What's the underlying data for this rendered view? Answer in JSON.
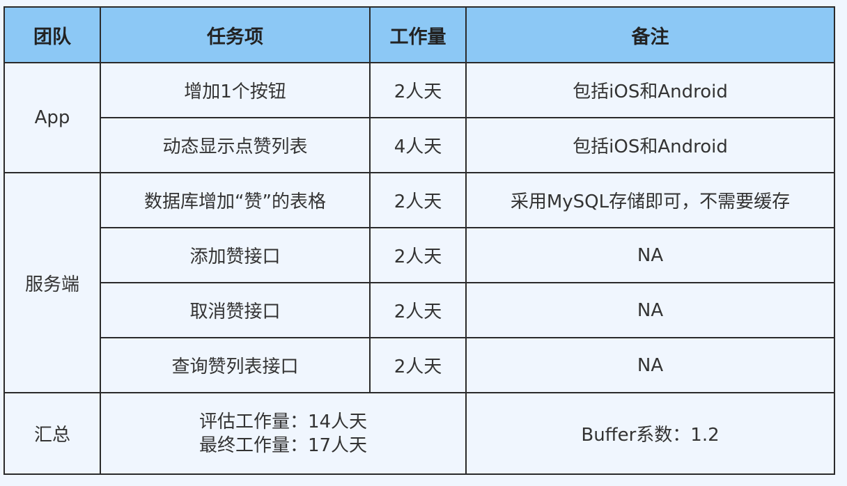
{
  "headers": [
    "团队",
    "任务项",
    "工作量",
    "备注"
  ],
  "groups": {
    "app": "App",
    "server": "服务端",
    "summary": "汇总"
  },
  "rows": [
    {
      "task": "增加1个按钮",
      "effort": "2人天",
      "note": "包括iOS和Android"
    },
    {
      "task": "动态显示点赞列表",
      "effort": "4人天",
      "note": "包括iOS和Android"
    },
    {
      "task": "数据库增加“赞”的表格",
      "effort": "2人天",
      "note": "采用MySQL存储即可，不需要缓存"
    },
    {
      "task": "添加赞接口",
      "effort": "2人天",
      "note": "NA"
    },
    {
      "task": "取消赞接口",
      "effort": "2人天",
      "note": "NA"
    },
    {
      "task": "查询赞列表接口",
      "effort": "2人天",
      "note": "NA"
    }
  ],
  "summary": {
    "estimated": "评估工作量：14人天",
    "final": "最终工作量：17人天",
    "buffer": "Buffer系数：1.2"
  },
  "colors": {
    "header_bg": "#8cc8f5",
    "body_bg": "#f0f6fe",
    "border": "#2a2a2a"
  }
}
